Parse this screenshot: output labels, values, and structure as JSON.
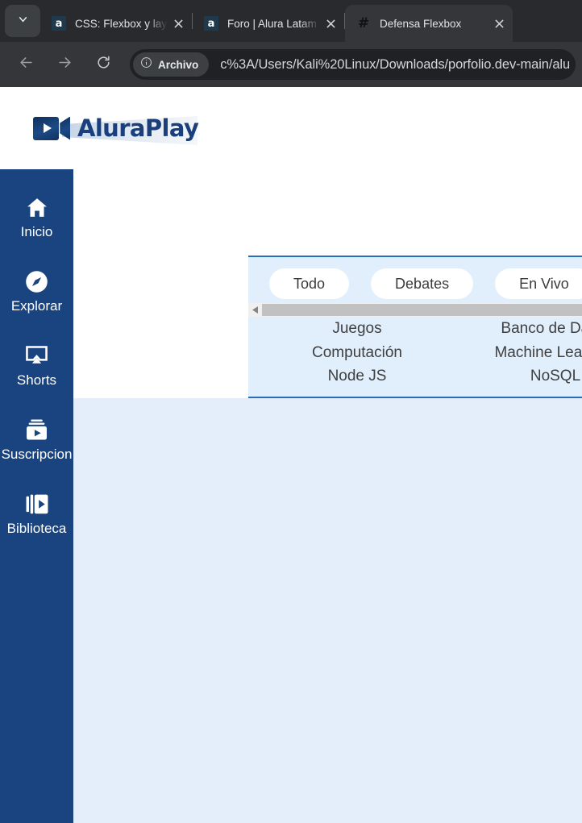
{
  "browser": {
    "tab_list_icon": "chevron-down-icon",
    "tabs": [
      {
        "favicon": "alura-a-icon",
        "title": "CSS: Flexbox y layout",
        "active": false
      },
      {
        "favicon": "alura-a-icon",
        "title": "Foro | Alura Latam - C",
        "active": false
      },
      {
        "favicon": "hash-icon",
        "title": "Defensa Flexbox",
        "active": true
      }
    ],
    "nav": {
      "back_icon": "arrow-left-icon",
      "forward_icon": "arrow-right-icon",
      "reload_icon": "reload-icon"
    },
    "omnibox": {
      "security_icon": "info-circle-icon",
      "security_label": "Archivo",
      "url": "c%3A/Users/Kali%20Linux/Downloads/porfolio.dev-main/alu"
    }
  },
  "page": {
    "logo": {
      "icon": "video-camera-play-icon",
      "text": "AluraPlay"
    },
    "sidebar": {
      "background": "#1a4480",
      "items": [
        {
          "icon": "home-icon",
          "label": "Inicio"
        },
        {
          "icon": "compass-icon",
          "label": "Explorar"
        },
        {
          "icon": "airplay-screen-icon",
          "label": "Shorts"
        },
        {
          "icon": "subscriptions-icon",
          "label": "Suscripcion"
        },
        {
          "icon": "video-library-icon",
          "label": "Biblioteca"
        }
      ]
    },
    "categories": {
      "background": "#e1eefc",
      "border_color": "#2b6cb8",
      "pills": [
        "Todo",
        "Debates",
        "En Vivo"
      ],
      "scrollbar": {
        "left_arrow_icon": "triangle-left-icon"
      },
      "columns": [
        {
          "items": [
            "Juegos",
            "Computación",
            "Node JS"
          ]
        },
        {
          "items": [
            "Banco de Datos",
            "Machine Learning",
            "NoSQL"
          ]
        }
      ]
    },
    "content_background": "#e4eefb"
  }
}
